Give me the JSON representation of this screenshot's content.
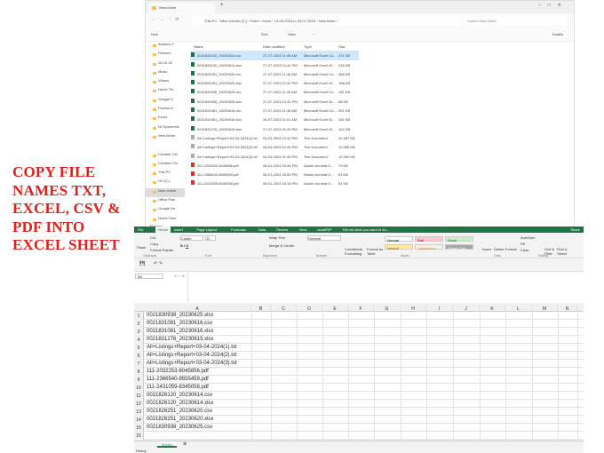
{
  "promo": {
    "text": "COPY FILE NAMES TXT, EXCEL, CSV & PDF INTO EXCEL SHEET"
  },
  "explorer": {
    "tab_title": "New folder",
    "breadcrumb": [
      "This PC",
      "New Volume (D:)",
      "Fiverr",
      "Excel",
      "13-06-2023 to 23-07-2023",
      "New folder"
    ],
    "search_placeholder": "Search New folder",
    "toolbar": {
      "new": "New",
      "sort": "Sort",
      "view": "View",
      "more": "···",
      "details": "Details"
    },
    "nav": [
      "Amazon T",
      "Pictures",
      "26-10-20",
      "Music",
      "Videos",
      "Home Tin",
      "Google D",
      "Product ir",
      "Excel",
      "Nt Syncentric",
      "New folder",
      "",
      "Creative Clo",
      "Creative Clo",
      "This PC",
      "OS (C:)",
      "New Volum",
      "Office Plac",
      "Google Dri",
      "Home Time"
    ],
    "columns": [
      "Name",
      "Date modified",
      "Type",
      "Size"
    ],
    "files": [
      {
        "name": "0021826120_20230614.csv",
        "date": "27-07-2023 11:49 AM",
        "type": "Microsoft Excel Co...",
        "size": "471 KB",
        "kind": "xl"
      },
      {
        "name": "0021826120_20230614.xlsx",
        "date": "27-07-2023 12:41 PM",
        "type": "Microsoft Excel W...",
        "size": "215 KB",
        "kind": "xl"
      },
      {
        "name": "0021826251_20230620.csv",
        "date": "27-07-2023 11:49 AM",
        "type": "Microsoft Excel Co...",
        "size": "368 KB",
        "kind": "xl"
      },
      {
        "name": "0021826251_20230620.xlsx",
        "date": "27-07-2023 12:42 PM",
        "type": "Microsoft Excel W...",
        "size": "168 KB",
        "kind": "xl"
      },
      {
        "name": "0021830938_20230625.csv",
        "date": "27-07-2023 11:49 AM",
        "type": "Microsoft Excel Co...",
        "size": "181 KB",
        "kind": "xl"
      },
      {
        "name": "0021830938_20230625.xlsx",
        "date": "27-07-2023 12:42 PM",
        "type": "Microsoft Excel W...",
        "size": "88 KB",
        "kind": "xl"
      },
      {
        "name": "0021831081_20230616.csv",
        "date": "27-07-2023 11:49 AM",
        "type": "Microsoft Excel Co...",
        "size": "391 KB",
        "kind": "xl"
      },
      {
        "name": "0021831081_20230616.xlsx",
        "date": "28-07-2023 11:01 AM",
        "type": "Microsoft Excel W...",
        "size": "181 KB",
        "kind": "xl"
      },
      {
        "name": "0021831276_20230615.xlsx",
        "date": "27-07-2023 01:00 PM",
        "type": "Microsoft Excel W...",
        "size": "162 KB",
        "kind": "xl"
      },
      {
        "name": "All+Listings+Report+03-04-2024(1).txt",
        "date": "04-03-2024 12:40 PM",
        "type": "Text Document",
        "size": "10,357 KB",
        "kind": "txt"
      },
      {
        "name": "All+Listings+Report+03-04-2024(2).txt",
        "date": "04-03-2024 12:49 PM",
        "type": "Text Document",
        "size": "10,358 KB",
        "kind": "txt"
      },
      {
        "name": "All+Listings+Report+03-04-2024(3).txt",
        "date": "04-03-2024 01:35 PM",
        "type": "Text Document",
        "size": "10,360 KB",
        "kind": "txt"
      },
      {
        "name": "111-2032253-6045856.pdf",
        "date": "08-01-2024 04:46 PM",
        "type": "Adobe Acrobat D...",
        "size": "79 KB",
        "kind": "pdf"
      },
      {
        "name": "111-2366540-8555459.pdf",
        "date": "08-01-2024 05:55 PM",
        "type": "Adobe Acrobat D...",
        "size": "83 KB",
        "kind": "pdf"
      },
      {
        "name": "111-2431059-8345058.pdf",
        "date": "08-01-2024 04:18 PM",
        "type": "Adobe Acrobat D...",
        "size": "81 KB",
        "kind": "pdf"
      }
    ],
    "status": "15 items"
  },
  "excel": {
    "tabs": [
      "File",
      "Home",
      "Insert",
      "Page Layout",
      "Formulas",
      "Data",
      "Review",
      "View",
      "novaPDF"
    ],
    "tell_me": "Tell me what you want to do...",
    "share": "Share",
    "ribbon": {
      "paste": "Paste",
      "cut": "Cut",
      "copy": "Copy",
      "format_painter": "Format Painter",
      "font": "Calibri",
      "size": "11",
      "wrap": "Wrap Text",
      "merge": "Merge & Center",
      "number_format": "General",
      "cond": "Conditional Formatting",
      "format_table": "Format as Table",
      "insert": "Insert",
      "delete": "Delete",
      "format": "Format",
      "autosum": "AutoSum",
      "fill": "Fill",
      "clear": "Clear",
      "sort": "Sort & Filter",
      "find": "Find & Select"
    },
    "styles": [
      {
        "label": "Normal",
        "bg": "#ffffff",
        "fg": "#000000"
      },
      {
        "label": "Bad",
        "bg": "#ffc7ce",
        "fg": "#9c0006"
      },
      {
        "label": "Good",
        "bg": "#c6efce",
        "fg": "#006100"
      },
      {
        "label": "Neutral",
        "bg": "#ffeb9c",
        "fg": "#9c5700"
      },
      {
        "label": "Calculation",
        "bg": "#f2f2f2",
        "fg": "#fa7d00"
      },
      {
        "label": "Check Cell",
        "bg": "#a5a5a5",
        "fg": "#ffffff"
      }
    ],
    "groups": [
      "Clipboard",
      "Font",
      "Alignment",
      "Number",
      "Styles",
      "Cells",
      "Editing"
    ],
    "name_box": "B5",
    "columns": [
      "A",
      "B",
      "C",
      "D",
      "E",
      "F",
      "G",
      "H",
      "I",
      "J",
      "K",
      "L",
      "M",
      "N"
    ],
    "rows": [
      "0021830938_20230625.xlsx",
      "0021831081_20230616.csv",
      "0021831081_20230616.xlsx",
      "0021831276_20230615.xlsx",
      "All+Listings+Report+03-04-2024(1).txt",
      "All+Listings+Report+03-04-2024(2).txt",
      "All+Listings+Report+03-04-2024(3).txt",
      "111-2032253-6045856.pdf",
      "111-2366540-8555459.pdf",
      "111-2431059-8345058.pdf",
      "0021826120_20230614.csv",
      "0021826120_20230614.xlsx",
      "0021826251_20230620.csv",
      "0021826251_20230620.xlsx",
      "0021830938_20230625.csv",
      ""
    ],
    "sheet": "Sheet1",
    "status": "Ready",
    "accent": "#217346"
  }
}
